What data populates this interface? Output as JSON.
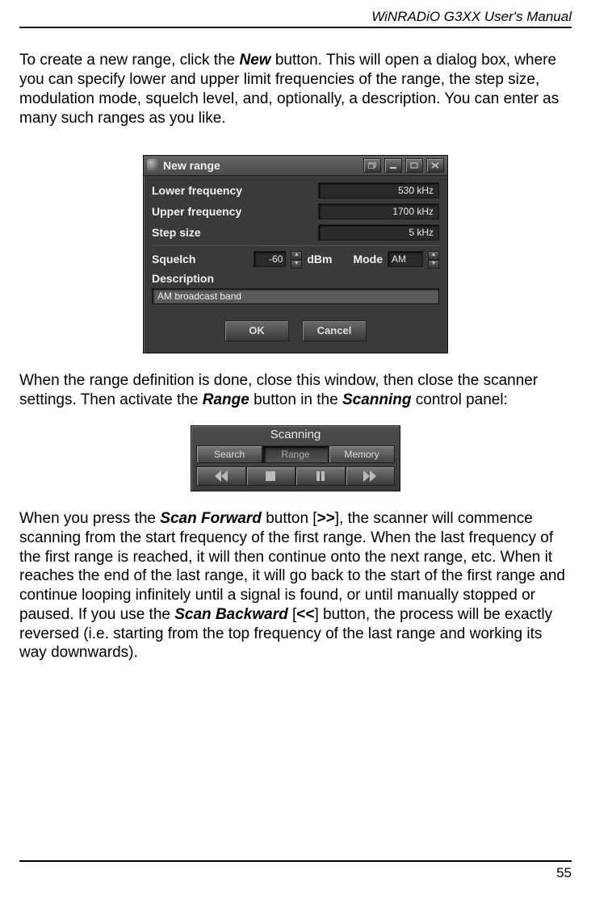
{
  "header": {
    "title": "WiNRADiO G3XX User's Manual"
  },
  "para1": {
    "pre": "To create a new range, click the ",
    "kw1": "New",
    "post": " button. This will open a dialog box, where you can specify lower and upper limit frequencies of the range, the step size, modulation mode, squelch level, and, optionally, a description. You can enter as many such ranges as you like."
  },
  "dialog": {
    "title": "New range",
    "lower_label": "Lower frequency",
    "lower_value": "530 kHz",
    "upper_label": "Upper frequency",
    "upper_value": "1700 kHz",
    "step_label": "Step size",
    "step_value": "5 kHz",
    "squelch_label": "Squelch",
    "squelch_value": "-60",
    "squelch_unit": "dBm",
    "mode_label": "Mode",
    "mode_value": "AM",
    "desc_label": "Description",
    "desc_value": "AM broadcast band",
    "ok": "OK",
    "cancel": "Cancel"
  },
  "para2": {
    "pre": "When the range definition is done, close this window, then close the scanner settings. Then activate the ",
    "kw1": "Range",
    "mid": " button in the ",
    "kw2": "Scanning",
    "post": " control panel:"
  },
  "scan": {
    "title": "Scanning",
    "search": "Search",
    "range": "Range",
    "memory": "Memory"
  },
  "para3": {
    "t1": "When you press the ",
    "kw1": "Scan Forward",
    "t2": " button [",
    "sym1": ">>",
    "t3": "], the scanner will commence scanning from the start frequency of the first range. When the last frequency of the first range is reached, it will then continue onto the next range, etc. When it reaches the end of the last range, it will go back to the start of the first range and continue looping infinitely until a signal is found, or until manually stopped or paused. If you use the ",
    "kw2": "Scan Backward",
    "t4": " [",
    "sym2": "<<",
    "t5": "] button, the process will be exactly reversed (i.e. starting from the top frequency of the last range and working its way downwards)."
  },
  "footer": {
    "page": "55"
  }
}
